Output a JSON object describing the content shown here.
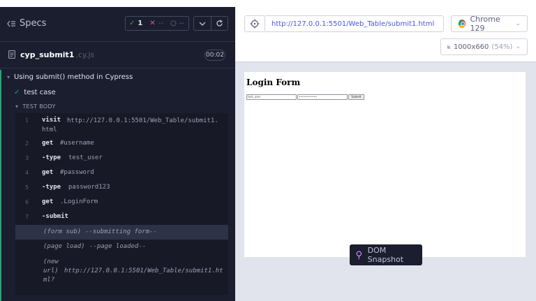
{
  "sidebar": {
    "specs_label": "Specs",
    "stats": {
      "passed": "1",
      "failed": "--",
      "pending": "--"
    },
    "file": {
      "name": "cyp_submit1",
      "ext": ".cy.js",
      "duration": "00:02"
    },
    "suite_title": "Using submit() method in Cypress",
    "test_title": "test case",
    "body_label": "TEST BODY",
    "commands": [
      {
        "num": "1",
        "name": "visit",
        "msg": "http://127.0.0.1:5501/Web_Table/submit1.html"
      },
      {
        "num": "2",
        "name": "get",
        "msg": "#username"
      },
      {
        "num": "3",
        "name": "-type",
        "msg": "test_user"
      },
      {
        "num": "4",
        "name": "get",
        "msg": "#password"
      },
      {
        "num": "5",
        "name": "-type",
        "msg": "password123"
      },
      {
        "num": "6",
        "name": "get",
        "msg": ".LoginForm"
      },
      {
        "num": "7",
        "name": "-submit",
        "msg": ""
      }
    ],
    "events": [
      {
        "label": "(form sub)",
        "msg": "--submitting form--"
      },
      {
        "label": "(page load)",
        "msg": "--page loaded--"
      },
      {
        "label": "(new url)",
        "msg": "http://127.0.0.1:5501/Web_Table/submit1.html?"
      }
    ]
  },
  "toolbar": {
    "url": "http://127.0.0.1:5501/Web_Table/submit1.html",
    "browser": "Chrome 129",
    "viewport": "1000x660",
    "viewport_scale": "(54%)"
  },
  "aut": {
    "title": "Login Form",
    "username_value": "test_user",
    "password_value": "•••••••••••",
    "submit_label": "Submit"
  },
  "snapshot_label": "DOM Snapshot",
  "colors": {
    "pass": "#1fa971",
    "fail": "#e45770",
    "url": "#4956e3",
    "panel": "#1b1e2e"
  }
}
